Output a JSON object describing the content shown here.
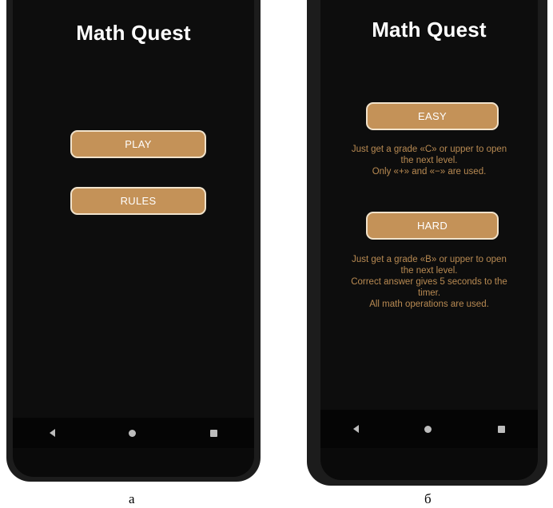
{
  "screen_a": {
    "title": "Math Quest",
    "play_label": "PLAY",
    "rules_label": "RULES",
    "caption": "а"
  },
  "screen_b": {
    "title": "Math Quest",
    "easy_label": "EASY",
    "easy_desc": [
      "Just get a grade «C» or upper to open",
      "the next level.",
      "Only «+» and «−» are used."
    ],
    "hard_label": "HARD",
    "hard_desc": [
      "Just get a grade «B» or upper to open",
      "the next level.",
      "Correct answer gives 5 seconds to the",
      "timer.",
      "All math operations are used."
    ],
    "caption": "б"
  },
  "nav_icons": [
    "back-icon",
    "home-icon",
    "recent-apps-icon"
  ],
  "colors": {
    "screen_bg": "#0d0d0d",
    "button_fill": "#c49258",
    "button_border": "#f1e3cc",
    "description_text": "#b88a52",
    "title_text": "#ffffff"
  }
}
